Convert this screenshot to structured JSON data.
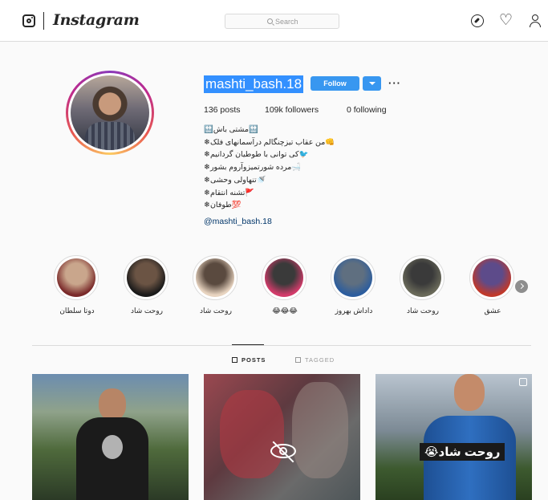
{
  "header": {
    "brand": "Instagram",
    "search_placeholder": "Search",
    "icons": [
      "instagram-glyph-icon",
      "explore-compass-icon",
      "heart-icon",
      "profile-icon"
    ]
  },
  "profile": {
    "username": "mashti_bash.18",
    "follow_label": "Follow",
    "stats": {
      "posts": "136 posts",
      "followers": "109k followers",
      "following": "0 following"
    },
    "bio_lines": [
      "🔛مشتی باش🔛",
      "👊من عقاب تیزچنگالم درآسمانهای فلک❄",
      "🐦کی توانی با طوطیان گردانیم❄",
      "🛁مرده شورتمیزوآروم بشور❄",
      "🚿تنهاولی وحشی❄",
      "🚩تشنه انتقام❄",
      "💯طوفان❄"
    ],
    "bio_link": "@mashti_bash.18"
  },
  "highlights": [
    {
      "label": "دوتا سلطان",
      "color_a": "#7a2a2a",
      "color_b": "#c9a68c"
    },
    {
      "label": "روحت شاد",
      "color_a": "#1a1a1a",
      "color_b": "#6b5444"
    },
    {
      "label": "روحت شاد",
      "color_a": "#e8d4c0",
      "color_b": "#5a4a3f"
    },
    {
      "label": "😂😂😂",
      "color_a": "#d23b6a",
      "color_b": "#3a3a3a"
    },
    {
      "label": "داداش بهروز",
      "color_a": "#2c5d9e",
      "color_b": "#5f6f80"
    },
    {
      "label": "روحت شاد",
      "color_a": "#6a6a5a",
      "color_b": "#3a3a3a"
    },
    {
      "label": "عشق",
      "color_a": "#c0392b",
      "color_b": "#5d4b8a"
    }
  ],
  "tabs": {
    "posts": "POSTS",
    "tagged": "TAGGED"
  },
  "posts": [
    {
      "kind": "photo"
    },
    {
      "kind": "sensitive-blurred"
    },
    {
      "kind": "photo",
      "caption": "روحت شاد😭"
    }
  ]
}
